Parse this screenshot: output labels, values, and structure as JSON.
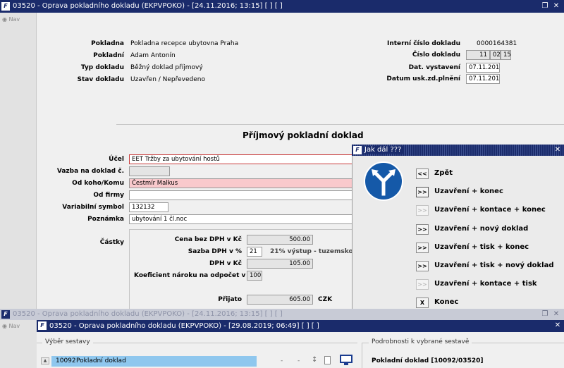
{
  "main_window": {
    "title": "03520 - Oprava pokladního dokladu (EKPVPOKO) - [24.11.2016; 13:15] [ ] [ ]",
    "nav_label": "Nav"
  },
  "header": {
    "pokladna_label": "Pokladna",
    "pokladna_value": "Pokladna recepce ubytovna Praha",
    "pokladni_label": "Pokladní",
    "pokladni_value": "Adam Antonín",
    "typ_label": "Typ dokladu",
    "typ_value": "Běžný doklad příjmový",
    "stav_label": "Stav dokladu",
    "stav_value": "Uzavřen / Nepřevedeno",
    "interni_label": "Interní číslo dokladu",
    "interni_value": "0000164381",
    "cislo_label": "Číslo dokladu",
    "cislo_part1": "11",
    "cislo_part2": "02",
    "cislo_part3": "15",
    "dat_vyst_label": "Dat. vystavení",
    "dat_vyst_value": "07.11.2016",
    "dat_usk_label": "Datum usk.zd.plnění",
    "dat_usk_value": "07.11.2016"
  },
  "form": {
    "section_title": "Příjmový pokladní doklad",
    "ucel_label": "Účel",
    "ucel_value": "EET Tržby za ubytování hostů",
    "vazba_label": "Vazba na doklad č.",
    "vazba_value": "",
    "odkoho_label": "Od koho/Komu",
    "odkoho_value": "Čestmír Malkus",
    "odfirmy_label": "Od firmy",
    "odfirmy_value": "",
    "vs_label": "Variabilní symbol",
    "vs_value": "132132",
    "poznamka_label": "Poznámka",
    "poznamka_value": "ubytování 1 čl.noc",
    "castky_label": "Částky",
    "cena_label": "Cena bez DPH v Kč",
    "cena_value": "500.00",
    "sazba_label": "Sazba DPH v %",
    "sazba_value": "21",
    "sazba_desc": "21% výstup - tuzemsko",
    "dph_label": "DPH v Kč",
    "dph_value": "105.00",
    "koef_label": "Koeficient nároku na odpočet v %",
    "koef_value": "100",
    "prijato_label": "Přijato",
    "prijato_value": "605.00",
    "currency": "CZK"
  },
  "dialog": {
    "title": "Jak dál ???",
    "buttons": [
      {
        "glyph": "<<",
        "label": "Zpět",
        "enabled": true
      },
      {
        "glyph": ">>",
        "label": "Uzavření + konec",
        "enabled": true
      },
      {
        "glyph": ">>",
        "label": "Uzavření + kontace + konec",
        "enabled": false
      },
      {
        "glyph": ">>",
        "label": "Uzavření + nový doklad",
        "enabled": true
      },
      {
        "glyph": ">>",
        "label": "Uzavření + tisk + konec",
        "enabled": true
      },
      {
        "glyph": ">>",
        "label": "Uzavření + tisk + nový doklad",
        "enabled": true
      },
      {
        "glyph": ">>",
        "label": "Uzavření + kontace + tisk",
        "enabled": false
      },
      {
        "glyph": "X",
        "label": "Konec",
        "enabled": true
      }
    ]
  },
  "ghost_window": {
    "title": "03520 - Oprava pokladního dokladu (EKPVPOKO) - [24.11.2016; 13:15] [ ] [ ]"
  },
  "front_window": {
    "title": "03520 - Oprava pokladního dokladu (EKPVPOKO) - [29.08.2019; 06:49] [ ] [ ]",
    "nav_label": "Nav",
    "vyber_label": "Výběr sestavy",
    "row_code": "10092",
    "row_name": "Pokladní doklad",
    "podrobnosti_label": "Podrobnosti k vybrané sestavě",
    "detail_title": "Pokladní doklad [10092/03520]"
  },
  "colors": {
    "titlebar": "#1a2b6b",
    "pink_field": "#f9c9cc",
    "selected_row": "#8fc7ee"
  }
}
